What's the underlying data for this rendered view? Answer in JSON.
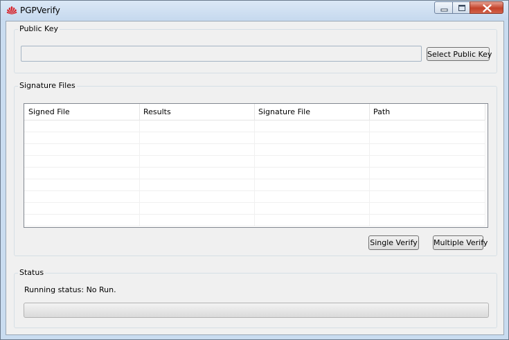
{
  "window": {
    "title": "PGPVerify"
  },
  "public_key": {
    "group_label": "Public Key",
    "path_value": "",
    "select_button": "Select Public Key"
  },
  "signature_files": {
    "group_label": "Signature Files",
    "columns": [
      "Signed File",
      "Results",
      "Signature File",
      "Path"
    ],
    "rows": [],
    "single_verify_button": "Single Verify",
    "multiple_verify_button": "Multiple Verify"
  },
  "status": {
    "group_label": "Status",
    "running_status": "Running status: No Run.",
    "progress": 0
  },
  "icons": {
    "app": "huawei-logo",
    "minimize": "minimize-icon",
    "maximize": "maximize-icon",
    "close": "close-icon"
  },
  "colors": {
    "logo_red": "#d71920",
    "close_red": "#c4432b",
    "title_bar": "#c9dcf0"
  }
}
